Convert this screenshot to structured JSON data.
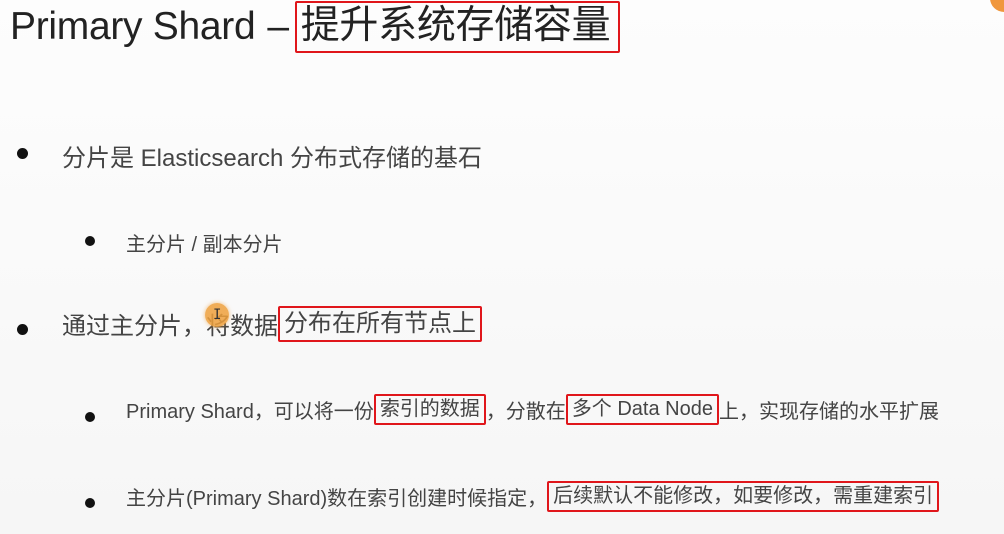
{
  "title": {
    "prefix": "Primary Shard",
    "dash": "–",
    "highlight": "提升系统存储容量"
  },
  "bullets": {
    "b1": {
      "text": "分片是 Elasticsearch 分布式存储的基石"
    },
    "b1_1": {
      "text": "主分片 / 副本分片"
    },
    "b2": {
      "pre": "通过主分片，将数据",
      "highlight": "分布在所有节点上"
    },
    "b2_1": {
      "pre": "Primary Shard，可以将一份",
      "hl1": "索引的数据",
      "mid": "，分散在",
      "hl2": "多个 Data Node",
      "post": " 上，实现存储的水平扩展"
    },
    "b2_2": {
      "pre": "主分片(Primary Shard)数在索引创建时候指定，",
      "highlight": "后续默认不能修改，如要修改，需重建索引"
    }
  },
  "colors": {
    "highlight_border": "#e0161b",
    "cursor": "#eea03c",
    "text": "#444444"
  }
}
